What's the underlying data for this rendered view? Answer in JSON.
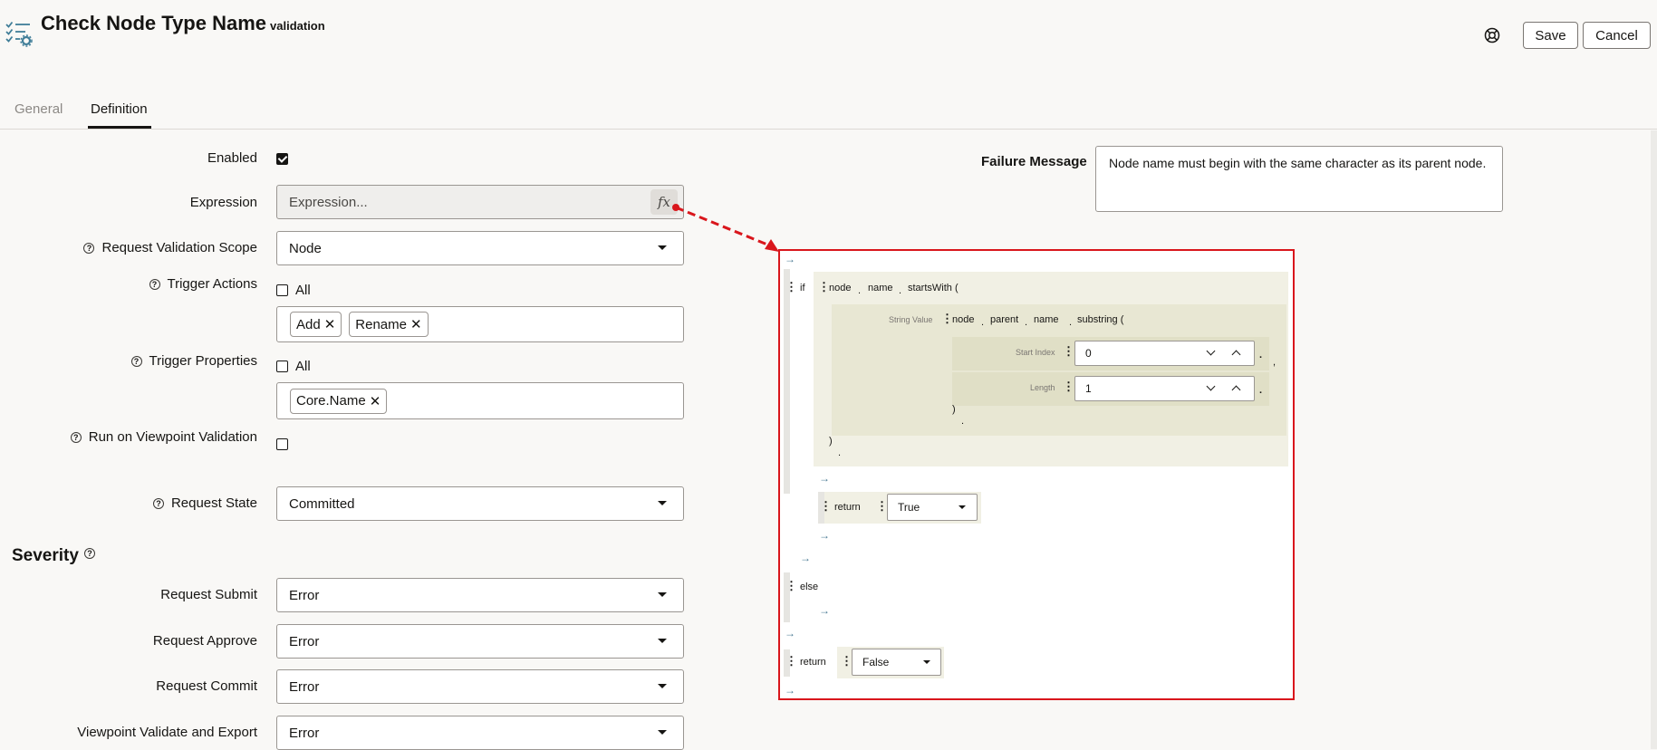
{
  "header": {
    "title": "Check Node Type Name",
    "subtitle": "validation",
    "save_label": "Save",
    "cancel_label": "Cancel"
  },
  "tabs": [
    {
      "label": "General",
      "active": false
    },
    {
      "label": "Definition",
      "active": true
    }
  ],
  "form": {
    "enabled_label": "Enabled",
    "enabled_checked": true,
    "expression_label": "Expression",
    "expression_placeholder": "Expression...",
    "fx_label": "fx",
    "scope_label": "Request Validation Scope",
    "scope_value": "Node",
    "trigger_actions_label": "Trigger Actions",
    "trigger_actions_all_label": "All",
    "trigger_actions_chips": [
      "Add",
      "Rename"
    ],
    "trigger_props_label": "Trigger Properties",
    "trigger_props_all_label": "All",
    "trigger_props_chips": [
      "Core.Name"
    ],
    "viewpoint_label": "Run on Viewpoint Validation",
    "state_label": "Request State",
    "state_value": "Committed",
    "severity_heading": "Severity",
    "severity": [
      {
        "label": "Request Submit",
        "value": "Error"
      },
      {
        "label": "Request Approve",
        "value": "Error"
      },
      {
        "label": "Request Commit",
        "value": "Error"
      },
      {
        "label": "Viewpoint Validate and Export",
        "value": "Error"
      }
    ],
    "chip_remove_glyph": "✕"
  },
  "failure": {
    "label": "Failure Message",
    "text": "Node name must begin with the same character as its parent node."
  },
  "expression_builder": {
    "if_kw": "if",
    "node": "node",
    "name": "name",
    "starts_with": "startsWith (",
    "string_value_label": "String Value",
    "parent": "parent",
    "substring": "substring (",
    "start_index_label": "Start Index",
    "start_index_value": "0",
    "length_label": "Length",
    "length_value": "1",
    "close_paren": ")",
    "return_kw": "return",
    "return_true": "True",
    "else_kw": "else",
    "return_false": "False",
    "arrow": "→",
    "dot": ".",
    "comma": ",",
    "kebab": "⋮"
  },
  "colors": {
    "highlight_border": "#d9161c",
    "if_block": "#f1f0e4",
    "nested_block": "#e8e7d3",
    "param_block": "#e0dfc6"
  }
}
